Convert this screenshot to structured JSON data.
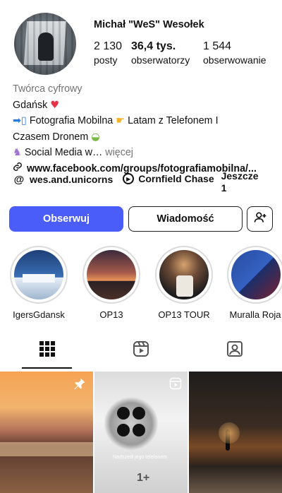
{
  "profile": {
    "username": "Michał \"WeS\" Wesołek",
    "stats": [
      {
        "value": "2 130",
        "label": "posty"
      },
      {
        "value": "36,4 tys.",
        "label": "obserwatorzy"
      },
      {
        "value": "1 544",
        "label": "obserwowanie"
      }
    ]
  },
  "bio": {
    "category": "Twórca cyfrowy",
    "line1": "Gdańsk",
    "line2": "Fotografia Mobilna",
    "line2b": "Latam z Telefonem I",
    "line3": "Czasem Dronem",
    "line4": "Social Media w…",
    "more": "więcej",
    "link": "www.facebook.com/groups/fotografiamobilna/..."
  },
  "chips": {
    "threads": "wes.and.unicorns",
    "song": "Cornfield Chase",
    "more": "Jeszcze 1"
  },
  "buttons": {
    "follow": "Obserwuj",
    "message": "Wiadomość"
  },
  "highlights": [
    {
      "label": "IgersGdansk"
    },
    {
      "label": "OP13"
    },
    {
      "label": "OP13 TOUR"
    },
    {
      "label": "Muralla Roja"
    }
  ],
  "grid": {
    "phone_caption": "Nadszedł jego telefonem"
  },
  "icons": {
    "grid": "grid-icon",
    "reels": "reels-icon",
    "tagged": "tagged-icon",
    "pin": "pin-icon",
    "add_user": "add-user-icon"
  },
  "colors": {
    "accent": "#4a5df9"
  }
}
